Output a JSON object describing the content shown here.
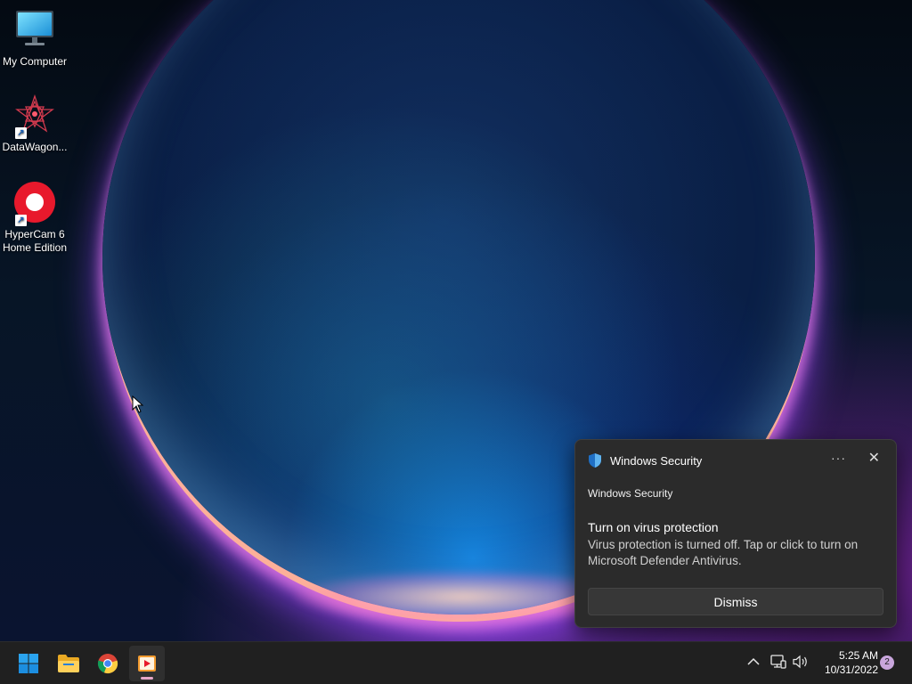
{
  "desktop": {
    "icons": [
      {
        "label": "My Computer",
        "icon": "monitor-icon",
        "shortcut": false
      },
      {
        "label": "DataWagon...",
        "icon": "datawagon-app-icon",
        "shortcut": true
      },
      {
        "label": "HyperCam 6\nHome Edition",
        "icon": "hypercam-app-icon",
        "shortcut": true
      }
    ]
  },
  "toast": {
    "app_name": "Windows Security",
    "app_icon": "shield-icon",
    "more_label": "···",
    "close_label": "✕",
    "subtitle": "Windows Security",
    "title": "Turn on virus protection",
    "body": "Virus protection is turned off. Tap or click to turn on Microsoft Defender Antivirus.",
    "dismiss_label": "Dismiss"
  },
  "taskbar": {
    "apps": [
      {
        "name": "start",
        "icon": "windows-logo-icon"
      },
      {
        "name": "file-explorer",
        "icon": "folder-icon"
      },
      {
        "name": "chrome",
        "icon": "chrome-icon"
      },
      {
        "name": "hypercam",
        "icon": "hypercam-taskbar-icon",
        "active": true
      }
    ],
    "tray": {
      "chevron": "^",
      "network_icon": "network-icon",
      "volume_icon": "volume-icon"
    },
    "clock": {
      "time": "5:25 AM",
      "date": "10/31/2022"
    },
    "notification_count": "2"
  },
  "colors": {
    "accent": "#3d9be9",
    "toast_bg": "#2b2b2b",
    "taskbar_bg": "#202020",
    "badge": "#c9a6dc"
  }
}
